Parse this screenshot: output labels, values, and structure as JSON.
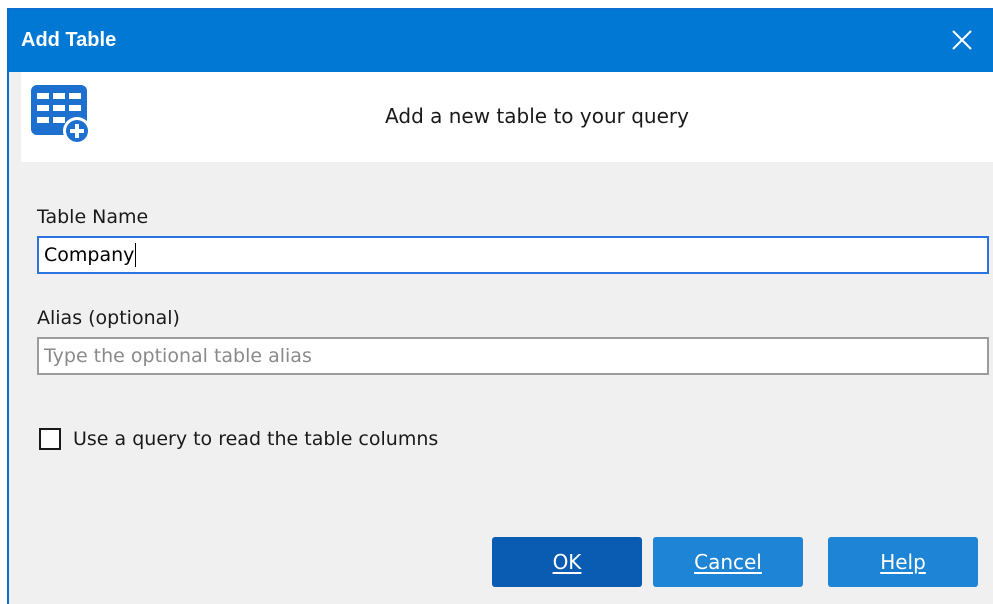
{
  "window": {
    "title": "Add Table"
  },
  "banner": {
    "icon": "table-add-icon",
    "text": "Add a new table to your query"
  },
  "form": {
    "table_name_label": "Table Name",
    "table_name_value": "Company",
    "alias_label": "Alias (optional)",
    "alias_value": "",
    "alias_placeholder": "Type the optional table alias",
    "use_query_label": "Use a query to read the table columns",
    "use_query_checked": false
  },
  "buttons": {
    "ok": "OK",
    "cancel": "Cancel",
    "help": "Help"
  },
  "colors": {
    "titlebar": "#0078d4",
    "primary_button": "#0a5cb3",
    "button": "#1d84d6",
    "focus_border": "#2b73e0"
  }
}
